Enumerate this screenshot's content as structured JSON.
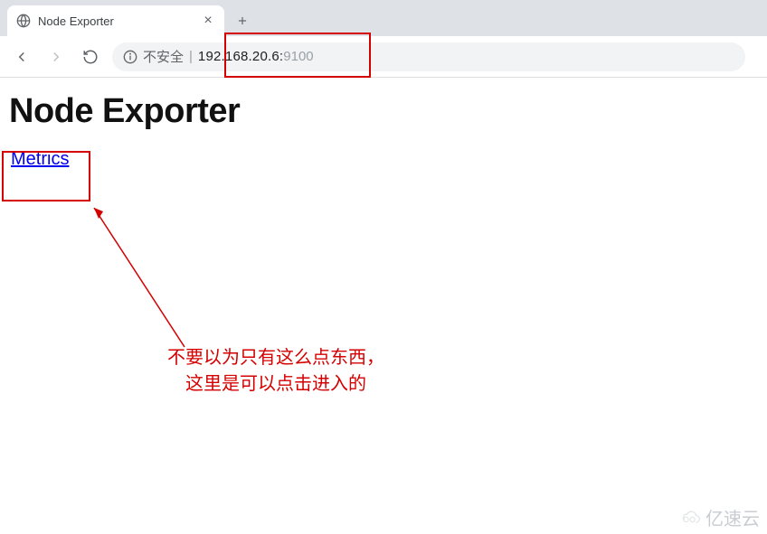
{
  "browser": {
    "tab_title": "Node Exporter",
    "new_tab_label": "+",
    "close_tab_label": "×"
  },
  "toolbar": {
    "back": "←",
    "forward": "→",
    "reload": "⟳"
  },
  "address_bar": {
    "insecure_label": "不安全",
    "separator": "|",
    "host": "192.168.20.6",
    "colon": ":",
    "port": "9100"
  },
  "page": {
    "heading": "Node Exporter",
    "link_label": "Metrics"
  },
  "annotation": {
    "line1": "不要以为只有这么点东西，",
    "line2": "这里是可以点击进入的"
  },
  "watermark": {
    "text": "亿速云"
  }
}
